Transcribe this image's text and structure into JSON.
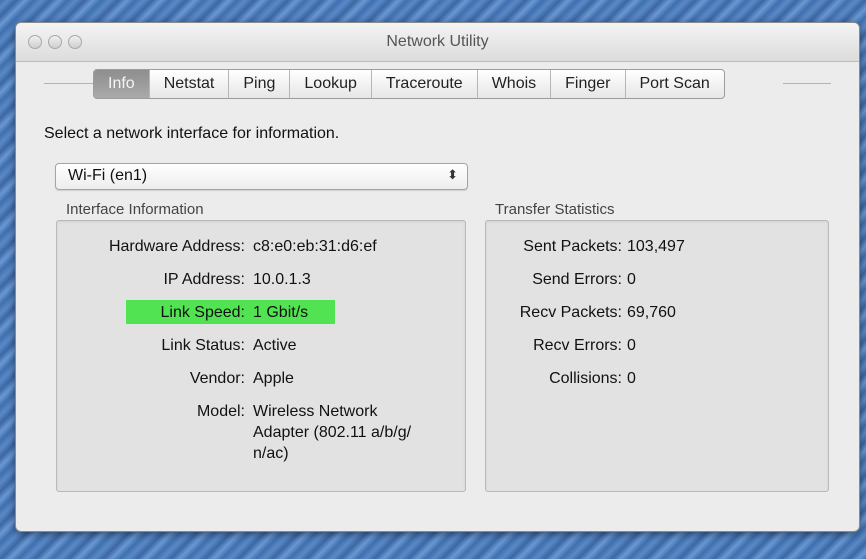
{
  "window": {
    "title": "Network Utility"
  },
  "tabs": [
    "Info",
    "Netstat",
    "Ping",
    "Lookup",
    "Traceroute",
    "Whois",
    "Finger",
    "Port Scan"
  ],
  "active_tab": "Info",
  "prompt": "Select a network interface for information.",
  "interface_select": {
    "value": "Wi-Fi (en1)",
    "arrows": "⬍"
  },
  "interface_info": {
    "heading": "Interface Information",
    "rows": [
      {
        "label": "Hardware Address:",
        "value": "c8:e0:eb:31:d6:ef"
      },
      {
        "label": "IP Address:",
        "value": "10.0.1.3"
      },
      {
        "label": "Link Speed:",
        "value": "1 Gbit/s",
        "highlighted": true
      },
      {
        "label": "Link Status:",
        "value": "Active"
      },
      {
        "label": "Vendor:",
        "value": "Apple"
      },
      {
        "label": "Model:",
        "value": "Wireless Network",
        "value2": "Adapter (802.11 a/b/g/",
        "value3": "n/ac)"
      }
    ]
  },
  "transfer_stats": {
    "heading": "Transfer Statistics",
    "rows": [
      {
        "label": "Sent Packets:",
        "value": "103,497"
      },
      {
        "label": "Send Errors:",
        "value": "0"
      },
      {
        "label": "Recv Packets:",
        "value": "69,760"
      },
      {
        "label": "Recv Errors:",
        "value": "0"
      },
      {
        "label": "Collisions:",
        "value": "0"
      }
    ]
  },
  "colors": {
    "highlight": "#52e352",
    "active_tab": "#9c9c9c"
  }
}
